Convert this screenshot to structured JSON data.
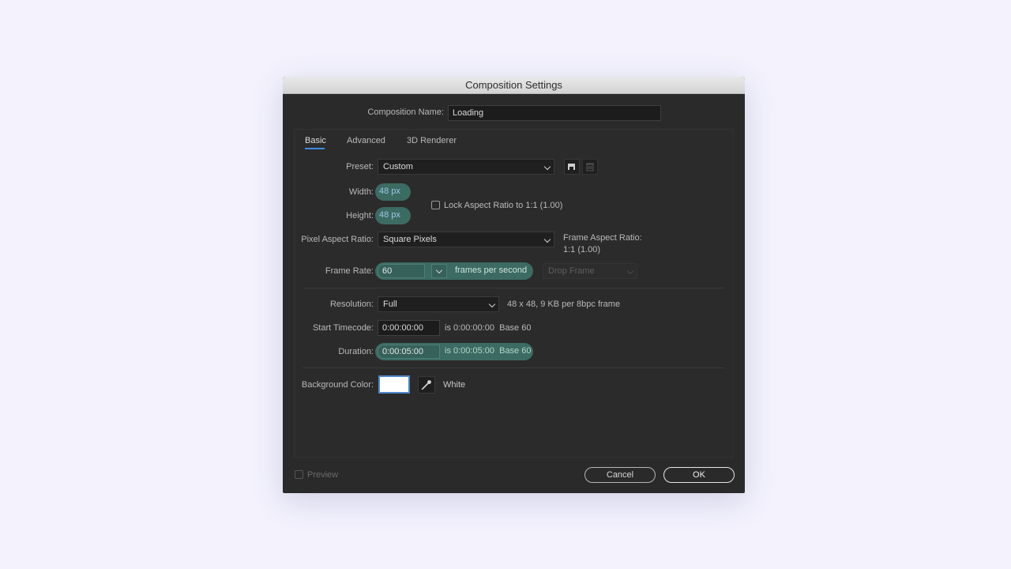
{
  "dialog": {
    "title": "Composition Settings",
    "comp_name_label": "Composition Name:",
    "comp_name_value": "Loading"
  },
  "tabs": [
    {
      "label": "Basic",
      "active": true
    },
    {
      "label": "Advanced",
      "active": false
    },
    {
      "label": "3D Renderer",
      "active": false
    }
  ],
  "basic": {
    "preset_label": "Preset:",
    "preset_value": "Custom",
    "width_label": "Width:",
    "width_value": "48 px",
    "height_label": "Height:",
    "height_value": "48 px",
    "lock_aspect_label": "Lock Aspect Ratio to 1:1 (1.00)",
    "lock_aspect_checked": false,
    "pixel_aspect_label": "Pixel Aspect Ratio:",
    "pixel_aspect_value": "Square Pixels",
    "frame_aspect_label": "Frame Aspect Ratio:",
    "frame_aspect_value": "1:1 (1.00)",
    "frame_rate_label": "Frame Rate:",
    "frame_rate_value": "60",
    "frame_rate_unit": "frames per second",
    "drop_frame_value": "Drop Frame",
    "resolution_label": "Resolution:",
    "resolution_value": "Full",
    "resolution_info": "48 x 48, 9 KB per 8bpc frame",
    "start_tc_label": "Start Timecode:",
    "start_tc_value": "0:00:00:00",
    "start_tc_info": "is 0:00:00:00  Base 60",
    "duration_label": "Duration:",
    "duration_value": "0:00:05:00",
    "duration_info": "is 0:00:05:00  Base 60",
    "bg_color_label": "Background Color:",
    "bg_color_hex": "#ffffff",
    "bg_color_name": "White"
  },
  "footer": {
    "preview_label": "Preview",
    "preview_checked": false,
    "cancel_label": "Cancel",
    "ok_label": "OK"
  },
  "colors": {
    "highlight_pill": "#3b6b62",
    "accent_blue": "#3d8be0",
    "dialog_bg": "#2a2a2a"
  }
}
